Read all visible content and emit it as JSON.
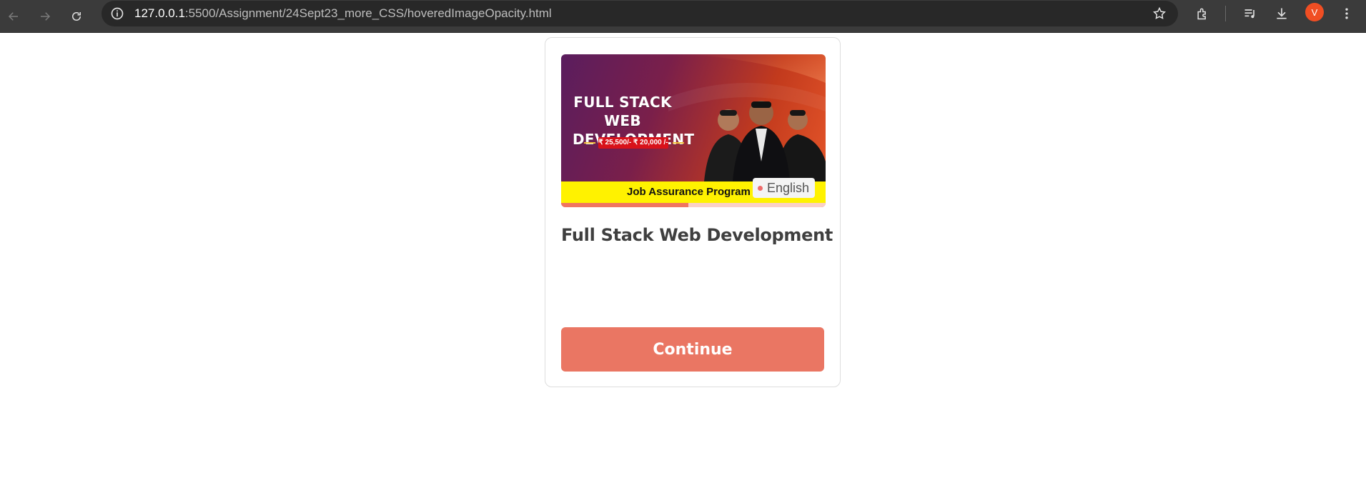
{
  "browser": {
    "url_host": "127.0.0.1",
    "url_path": ":5500/Assignment/24Sept23_more_CSS/hoveredImageOpacity.html",
    "profile_initial": "V",
    "icons": [
      "back-arrow-icon",
      "forward-arrow-icon",
      "reload-icon",
      "site-info-icon",
      "bookmark-star-icon",
      "extensions-icon",
      "reading-list-icon",
      "download-icon",
      "more-menu-icon"
    ]
  },
  "card": {
    "banner": {
      "title_line1": "FULL STACK",
      "title_line2": "WEB DEVELOPMENT",
      "price_text": "₹ 25,500/- ₹ 20,000 /-",
      "strip_text": "Job Assurance Program",
      "language": "English",
      "progress_percent": 48
    },
    "title": "Full Stack Web Development",
    "continue_label": "Continue"
  },
  "colors": {
    "accent": "#ea7663",
    "progress_fill": "#f07560",
    "progress_track": "#fbd0c6",
    "banner_strip": "#fff200",
    "avatar": "#f04e23"
  }
}
